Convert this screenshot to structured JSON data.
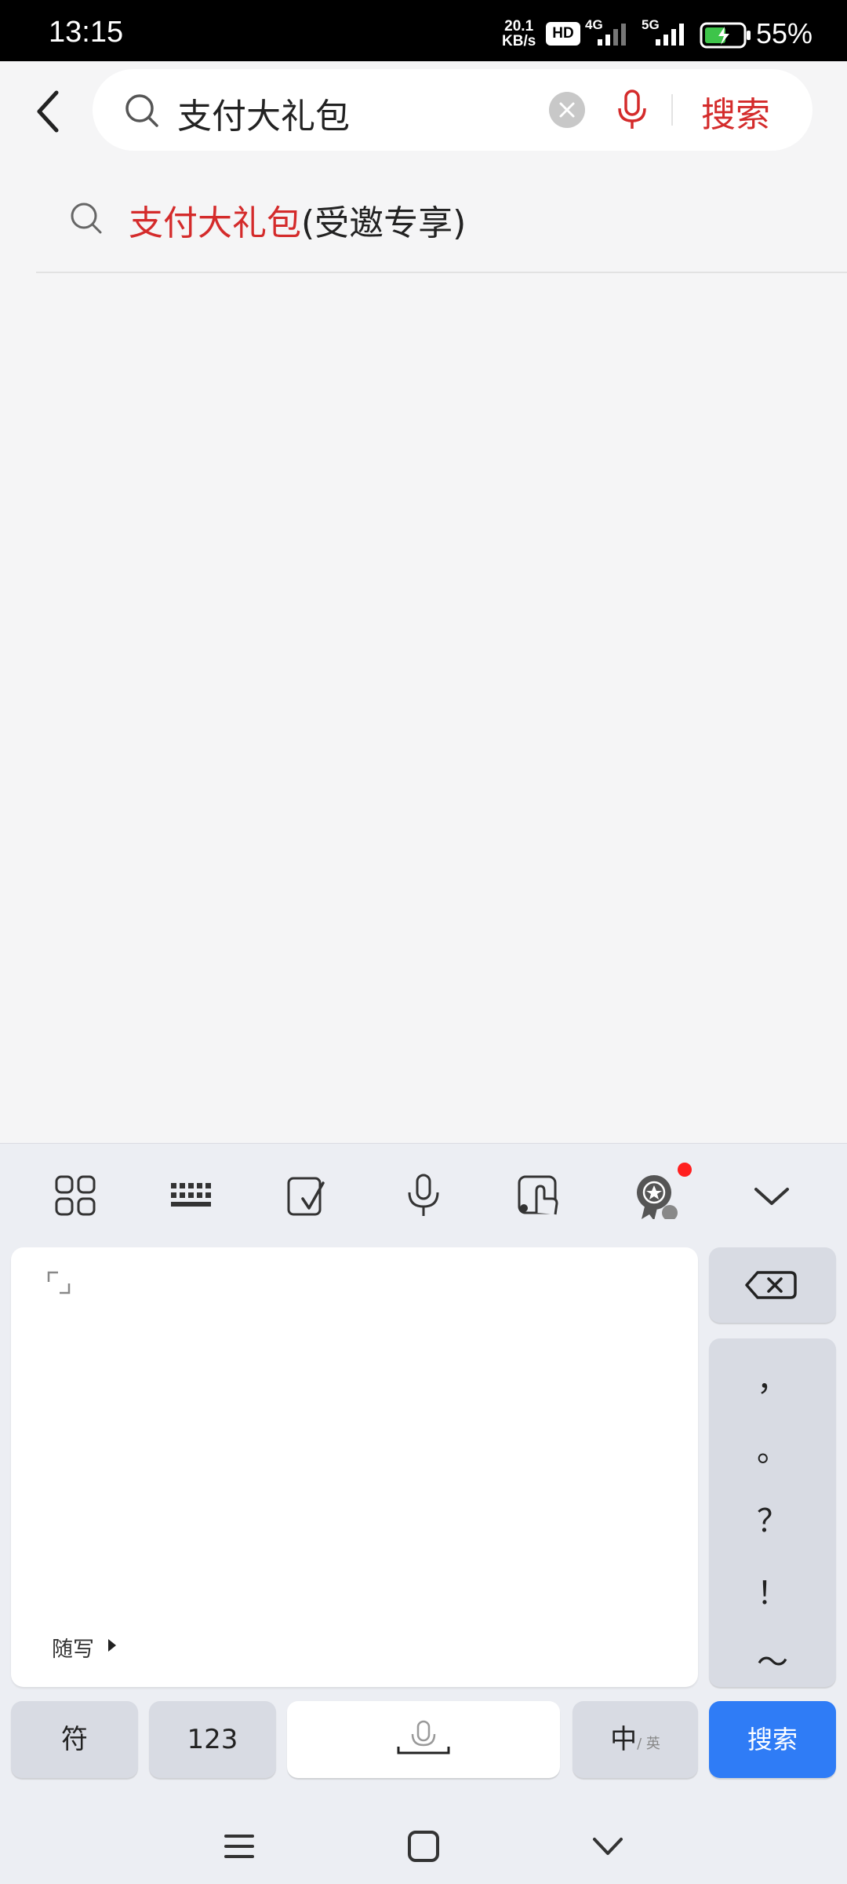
{
  "status_bar": {
    "time": "13:15",
    "net_speed_value": "20.1",
    "net_speed_unit": "KB/s",
    "hd_label": "HD",
    "sim1_label": "4G",
    "sim2_label": "5G",
    "battery_percent": "55%"
  },
  "header": {
    "search_query": "支付大礼包",
    "search_button_label": "搜索"
  },
  "suggestions": [
    {
      "highlight": "支付大礼包",
      "rest": "(受邀专享)"
    }
  ],
  "keyboard": {
    "toolbar": [
      "apps-grid-icon",
      "keyboard-icon",
      "handwriting-icon",
      "microphone-icon",
      "touch-icon",
      "badge-icon",
      "collapse-icon"
    ],
    "handwriting_label": "随写",
    "punctuation": [
      "，",
      "。",
      "？",
      "！",
      "～"
    ],
    "keys": {
      "symbols": "符",
      "numbers": "123",
      "lang_main": "中",
      "lang_sub": "/ 英",
      "search": "搜索"
    }
  },
  "nav_bar": [
    "menu-icon",
    "home-icon",
    "back-icon"
  ],
  "colors": {
    "accent_red": "#d42b2b",
    "keyboard_blue": "#2f7cf6",
    "notification_red": "#ff1f1f"
  }
}
